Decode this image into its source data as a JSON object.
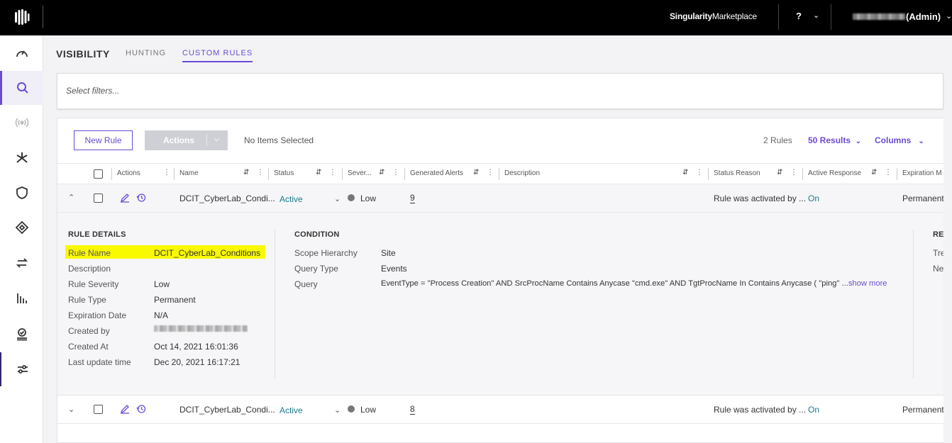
{
  "topbar": {
    "brand_bold": "Singularity",
    "brand_light": "Marketplace",
    "help_label": "?",
    "user_role": "(Admin)"
  },
  "sidebar": {
    "items": [
      "dashboard-icon",
      "search-icon",
      "broadcast-icon",
      "asterisk-icon",
      "shield-icon",
      "tag-icon",
      "sync-icon",
      "bar-chart-icon",
      "badge-icon",
      "sliders-icon"
    ],
    "active_index": 1
  },
  "header": {
    "title": "VISIBILITY",
    "tabs": [
      {
        "label": "HUNTING",
        "active": false
      },
      {
        "label": "CUSTOM RULES",
        "active": true
      }
    ]
  },
  "filter": {
    "placeholder": "Select filters..."
  },
  "toolbar": {
    "new_rule_label": "New Rule",
    "actions_label": "Actions",
    "selection_text": "No Items Selected",
    "rules_count": "2 Rules",
    "results_label": "50 Results",
    "columns_label": "Columns"
  },
  "table": {
    "columns": [
      "Actions",
      "Name",
      "Status",
      "Sever...",
      "Generated Alerts",
      "Description",
      "Status Reason",
      "Active Response",
      "Expiration M"
    ],
    "rows": [
      {
        "name": "DCIT_CyberLab_Condi...",
        "status": "Active",
        "severity": "Low",
        "alerts": "9",
        "status_reason": "Rule was activated by ...",
        "active_response": "On",
        "expiration": "Permanent",
        "expanded": true
      },
      {
        "name": "DCIT_CyberLab_Condi...",
        "status": "Active",
        "severity": "Low",
        "alerts": "8",
        "status_reason": "Rule was activated by ...",
        "active_response": "On",
        "expiration": "Permanent",
        "expanded": false
      }
    ]
  },
  "details": {
    "rule_details_title": "RULE DETAILS",
    "rule_details": [
      {
        "label": "Rule Name",
        "value": "DCIT_CyberLab_Conditions"
      },
      {
        "label": "Description",
        "value": ""
      },
      {
        "label": "Rule Severity",
        "value": "Low"
      },
      {
        "label": "Rule Type",
        "value": "Permanent"
      },
      {
        "label": "Expiration Date",
        "value": "N/A"
      },
      {
        "label": "Created by",
        "value": ""
      },
      {
        "label": "Created At",
        "value": "Oct 14, 2021 16:01:36"
      },
      {
        "label": "Last update time",
        "value": "Dec 20, 2021 16:17:21"
      }
    ],
    "condition_title": "CONDITION",
    "condition": [
      {
        "label": "Scope Hierarchy",
        "value": "Site"
      },
      {
        "label": "Query Type",
        "value": "Events"
      },
      {
        "label": "Query",
        "value": "EventType = \"Process Creation\" AND SrcProcName Contains Anycase \"cmd.exe\" AND TgtProcName In Contains Anycase ( \"ping\" ..."
      }
    ],
    "show_more": "show more",
    "response_title": "RES",
    "response_labels": [
      "Tre",
      "Ne"
    ]
  },
  "colors": {
    "accent": "#6b4bd4",
    "status_teal": "#1a7a8a",
    "highlight": "#f9f900"
  }
}
